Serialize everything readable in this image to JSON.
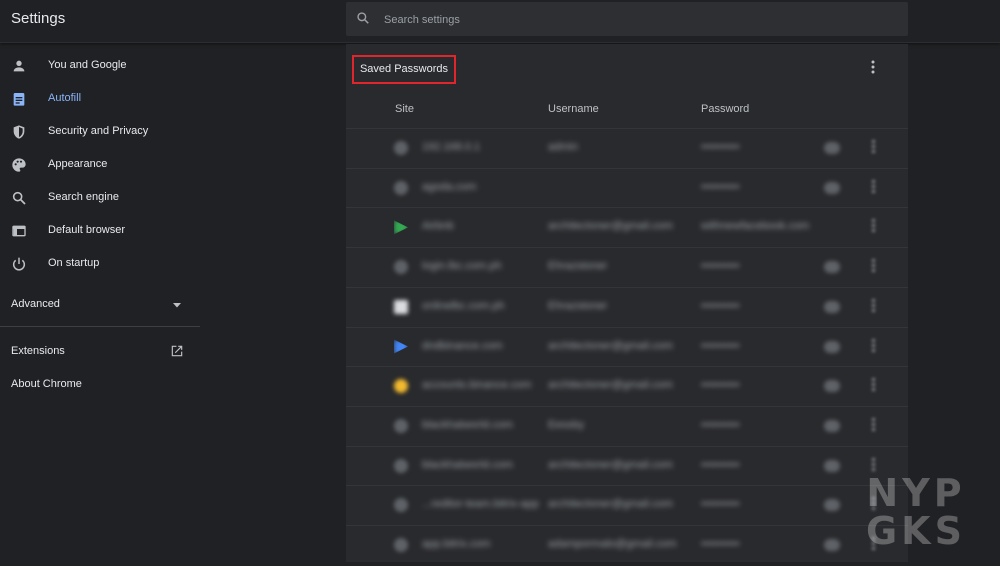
{
  "app": {
    "title": "Settings"
  },
  "search": {
    "placeholder": "Search settings"
  },
  "sidebar": {
    "items": [
      {
        "label": "You and Google",
        "icon": "person-icon",
        "active": false
      },
      {
        "label": "Autofill",
        "icon": "clipboard-icon",
        "active": true
      },
      {
        "label": "Security and Privacy",
        "icon": "shield-icon",
        "active": false
      },
      {
        "label": "Appearance",
        "icon": "palette-icon",
        "active": false
      },
      {
        "label": "Search engine",
        "icon": "search-icon",
        "active": false
      },
      {
        "label": "Default browser",
        "icon": "browser-icon",
        "active": false
      },
      {
        "label": "On startup",
        "icon": "power-icon",
        "active": false
      }
    ],
    "advanced_label": "Advanced",
    "extensions_label": "Extensions",
    "about_label": "About Chrome"
  },
  "passwords": {
    "title": "Saved Passwords",
    "columns": {
      "site": "Site",
      "username": "Username",
      "password": "Password"
    },
    "rows": [
      {
        "site": "192.168.0.1",
        "username": "admin",
        "password": "••••••••••"
      },
      {
        "site": "agoda.com",
        "username": "",
        "password": "••••••••••"
      },
      {
        "site": "Airbnb",
        "username": "architectoner@gmail.com",
        "password": "withnewfacebook.com"
      },
      {
        "site": "login.lbc.com.ph",
        "username": "Ehrazstoner",
        "password": "••••••••••"
      },
      {
        "site": "onlinelbc.com.ph",
        "username": "Ehrazstoner",
        "password": "••••••••••"
      },
      {
        "site": "dndbinance.com",
        "username": "architectoner@gmail.com",
        "password": "••••••••••"
      },
      {
        "site": "accounts.binance.com",
        "username": "architectoner@gmail.com",
        "password": "••••••••••"
      },
      {
        "site": "blackhatworld.com",
        "username": "Eessby",
        "password": "••••••••••"
      },
      {
        "site": "blackhatworld.com",
        "username": "architectoner@gmail.com",
        "password": "••••••••••"
      },
      {
        "site": "...reditor-team.bitrix-app",
        "username": "architectoner@gmail.com",
        "password": "••••••••••"
      },
      {
        "site": "app.bitrix.com",
        "username": "adampormalo@gmail.com",
        "password": "••••••••••"
      }
    ]
  },
  "watermark": {
    "line1": "NYP",
    "line2": "GKS"
  },
  "colors": {
    "accent": "#8ab4f8",
    "highlight_border": "#e0262c",
    "background": "#202124",
    "card": "#292a2d"
  }
}
